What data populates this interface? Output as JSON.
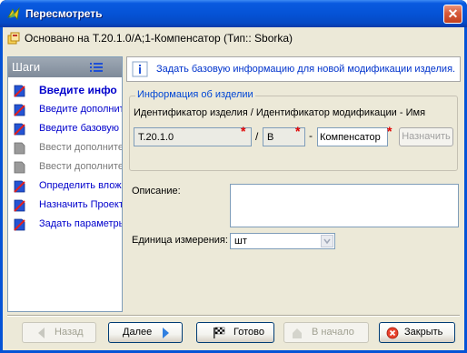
{
  "window": {
    "title": "Пересмотреть"
  },
  "header": {
    "based_on": "Основано на Т.20.1.0/А;1-Компенсатор (Тип:: Sborka)"
  },
  "sidebar": {
    "title": "Шаги",
    "steps": [
      {
        "label": "Введите инфо",
        "state": "active",
        "icon": "step-incomplete-icon"
      },
      {
        "label": "Введите дополнит",
        "state": "normal",
        "icon": "step-incomplete-icon"
      },
      {
        "label": "Введите базовую",
        "state": "normal",
        "icon": "step-incomplete-icon"
      },
      {
        "label": "Ввести дополните",
        "state": "disabled",
        "icon": "step-disabled-icon"
      },
      {
        "label": "Ввести дополните",
        "state": "disabled",
        "icon": "step-disabled-icon"
      },
      {
        "label": "Определить влож",
        "state": "normal",
        "icon": "step-incomplete-icon"
      },
      {
        "label": "Назначить Проект",
        "state": "normal",
        "icon": "step-incomplete-icon"
      },
      {
        "label": "Задать параметры",
        "state": "normal",
        "icon": "step-incomplete-icon"
      }
    ]
  },
  "info": {
    "message": "Задать базовую информацию для новой модификации изделия."
  },
  "item_info": {
    "legend": "Информация об изделии",
    "label": "Идентификатор изделия / Идентификатор модификации - Имя",
    "item_id": "Т.20.1.0",
    "slash": "/",
    "revision_id": "В",
    "dash": "-",
    "name": "Компенсатор",
    "assign_button": "Назначить"
  },
  "description": {
    "label": "Описание:",
    "value": ""
  },
  "unit": {
    "label": "Единица измерения:",
    "value": "шт"
  },
  "buttons": {
    "back": "Назад",
    "next": "Далее",
    "finish": "Готово",
    "to_start": "В начало",
    "close": "Закрыть"
  },
  "colors": {
    "title_bar": "#0553d6",
    "link_text": "#0000cc",
    "info_text": "#0033cc",
    "required_star": "#e00000"
  }
}
